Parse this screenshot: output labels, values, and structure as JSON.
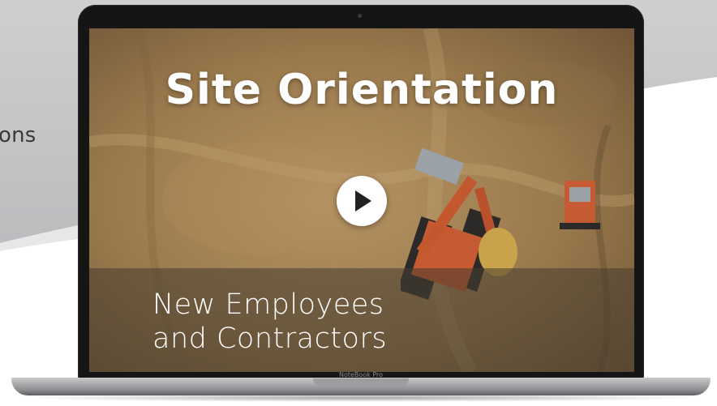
{
  "background": {
    "side_text": "ons"
  },
  "video": {
    "title": "Site Orientation",
    "subtitle_line1": "New Employees",
    "subtitle_line2": "and Contractors",
    "play_icon": "play-icon"
  },
  "device": {
    "brand_label": "NoteBook Pro"
  },
  "colors": {
    "overlay": "#463c30",
    "play_bg": "#ffffff",
    "ground": "#9a7a4a"
  }
}
